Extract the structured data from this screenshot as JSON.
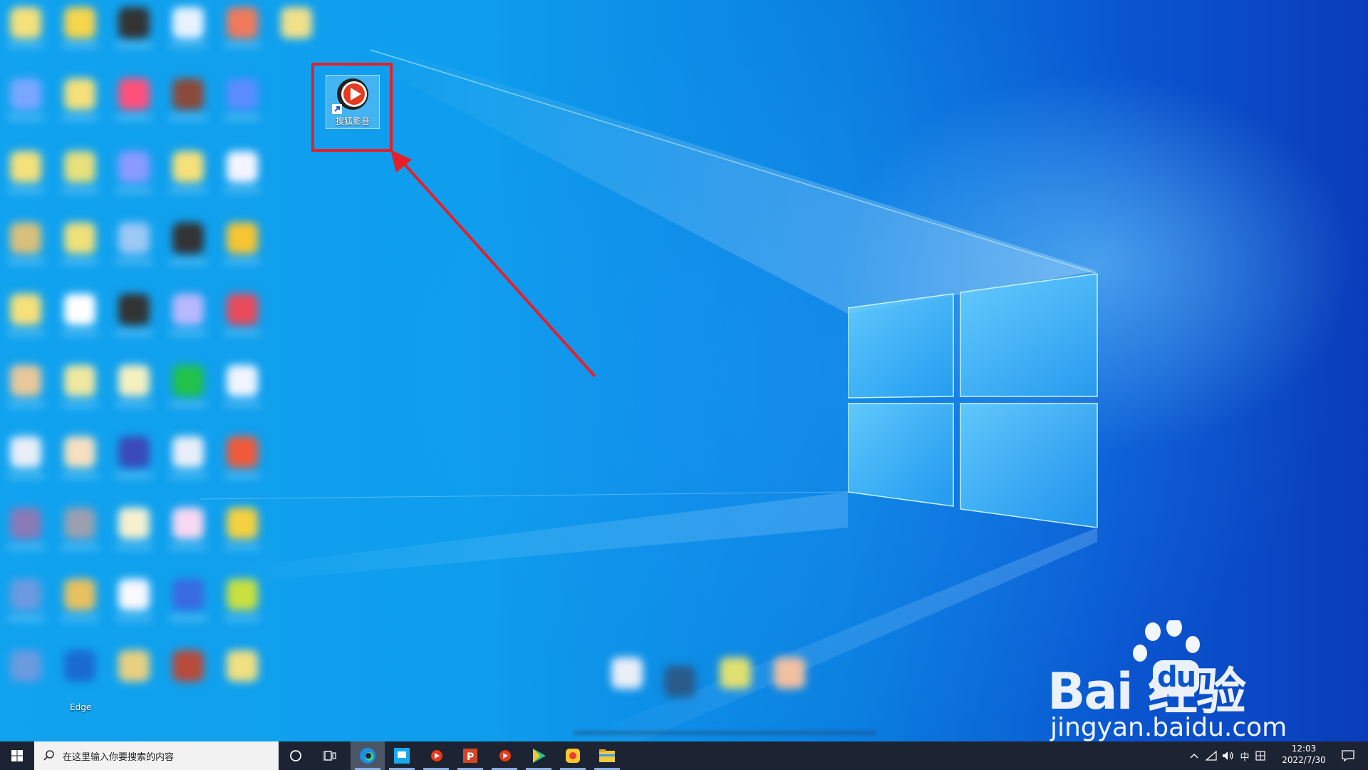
{
  "desktop": {
    "highlighted_shortcut_label": "搜狐影音",
    "edge_label": "Edge"
  },
  "watermark": {
    "brand": "Bai 经验",
    "brand_du": "du",
    "url": "jingyan.baidu.com"
  },
  "taskbar": {
    "search_placeholder": "在这里输入你要搜索的内容",
    "ime_label": "中",
    "time": "12:03",
    "date": "2022/7/30"
  },
  "colors": {
    "highlight": "#e5202a",
    "taskbar": "#1c2433"
  },
  "icons": {
    "start": "windows-start-icon",
    "search": "search-icon",
    "cortana": "cortana-circle-icon",
    "taskview": "task-view-icon",
    "apps": [
      "edge-icon",
      "app-blue-icon",
      "sohu-video-icon",
      "powerpoint-icon",
      "sohu-video-icon",
      "player-icon",
      "yellow-app-icon",
      "file-explorer-icon"
    ]
  }
}
